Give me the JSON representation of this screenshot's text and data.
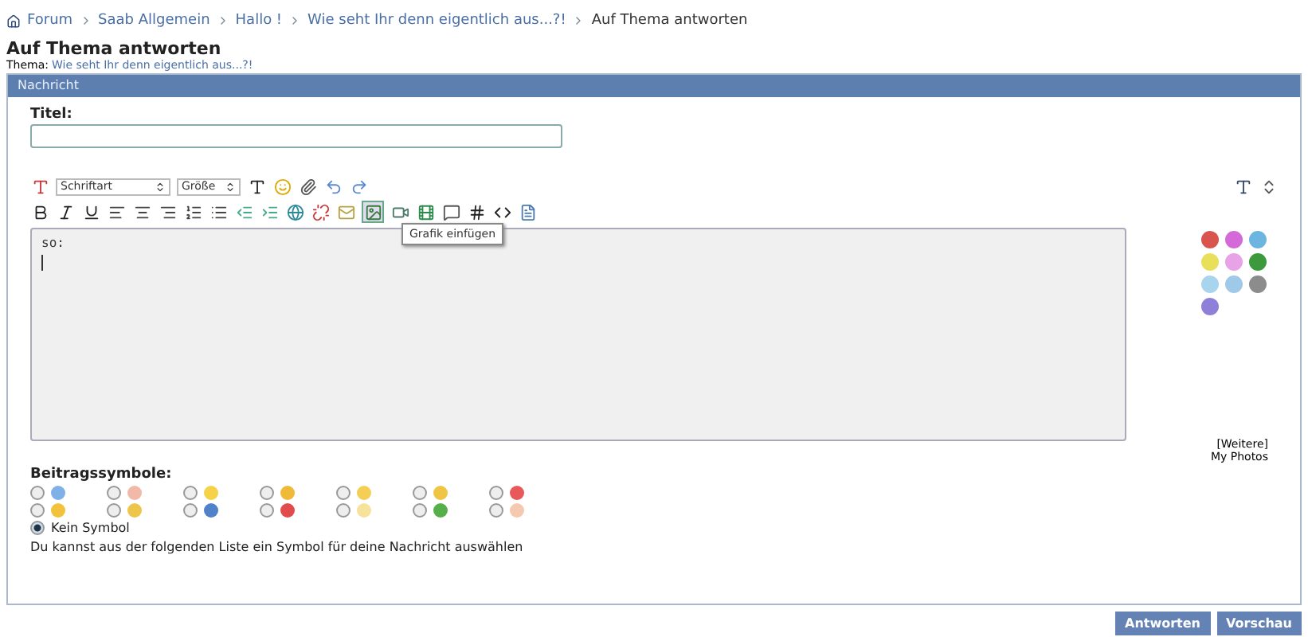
{
  "breadcrumbs": [
    {
      "label": "Forum",
      "current": false
    },
    {
      "label": "Saab Allgemein",
      "current": false
    },
    {
      "label": "Hallo !",
      "current": false
    },
    {
      "label": "Wie seht Ihr denn eigentlich aus...?!",
      "current": false
    },
    {
      "label": "Auf Thema antworten",
      "current": true
    }
  ],
  "page_title": "Auf Thema antworten",
  "topic": {
    "label": "Thema:",
    "link": "Wie seht Ihr denn eigentlich aus...?!"
  },
  "panel": {
    "title": "Nachricht"
  },
  "title_field": {
    "label": "Titel:"
  },
  "toolbar": {
    "font_select": "Schriftart",
    "size_select": "Größe",
    "tooltip": "Grafik einfügen"
  },
  "editor": {
    "lines": [
      "so:"
    ]
  },
  "smileys": [
    {
      "color": "#d9534f"
    },
    {
      "color": "#d46ad8"
    },
    {
      "color": "#6bb5e0"
    },
    {
      "color": "#e8e05a"
    },
    {
      "color": "#e7a3e6"
    },
    {
      "color": "#3c9a3c"
    },
    {
      "color": "#a8d4ee"
    },
    {
      "color": "#9fc9e8"
    },
    {
      "color": "#8c8c8c"
    },
    {
      "color": "#8f7fd8"
    }
  ],
  "more_link": "[Weitere]",
  "photos_link": "My Photos",
  "post_icons": {
    "label": "Beitragssymbole:",
    "items": [
      {
        "color": "#7fb1e8",
        "selected": false
      },
      {
        "color": "#f2b8a8",
        "selected": false
      },
      {
        "color": "#f5d24a",
        "selected": false
      },
      {
        "color": "#f0b93a",
        "selected": false
      },
      {
        "color": "#f5cf55",
        "selected": false
      },
      {
        "color": "#f0c545",
        "selected": false
      },
      {
        "color": "#e85a5a",
        "selected": false
      },
      {
        "color": "#f2c23c",
        "selected": false
      },
      {
        "color": "#eec54a",
        "selected": false
      },
      {
        "color": "#4f82c8",
        "selected": false
      },
      {
        "color": "#e24b4b",
        "selected": false
      },
      {
        "color": "#f6e29a",
        "selected": false
      },
      {
        "color": "#55b04a",
        "selected": false
      },
      {
        "color": "#f4c9b0",
        "selected": false
      }
    ],
    "none": {
      "label": "Kein Symbol",
      "selected": true
    },
    "hint": "Du kannst aus der folgenden Liste ein Symbol für deine Nachricht auswählen"
  },
  "buttons": [
    "Antworten",
    "Vorschau"
  ]
}
